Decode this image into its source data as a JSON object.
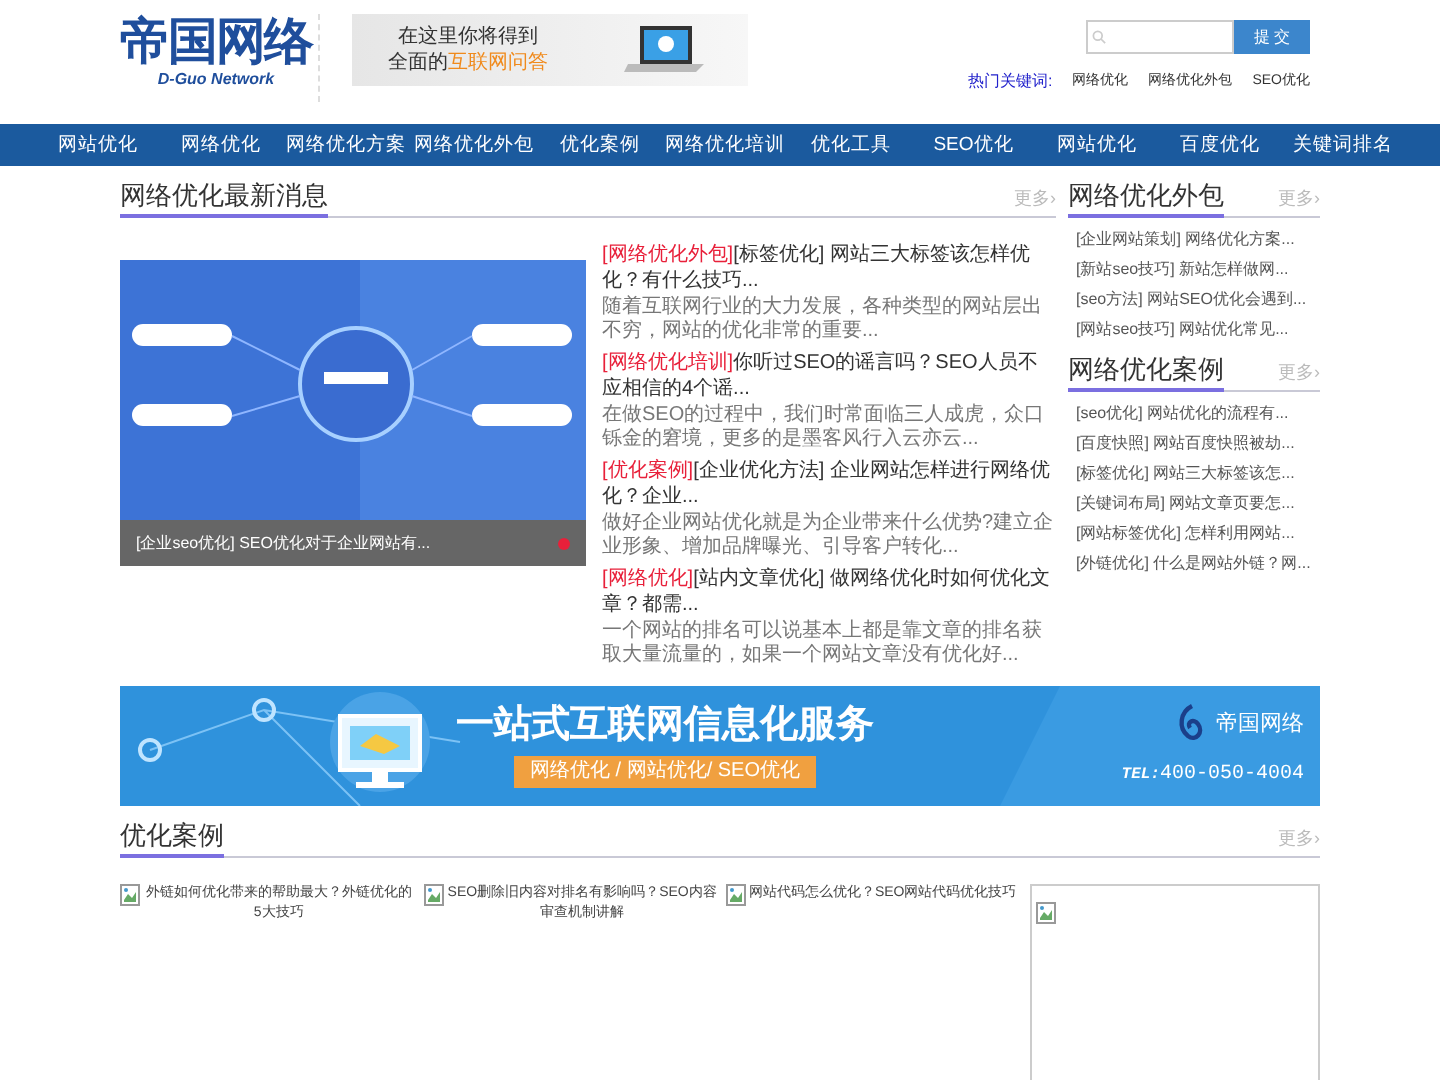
{
  "header": {
    "logo": {
      "name": "帝国网络",
      "subtitle": "D-Guo Network"
    },
    "ad": {
      "line1": "在这里你将得到",
      "line2_prefix": "全面的",
      "line2_highlight": "互联网问答"
    },
    "search": {
      "button": "提 交"
    },
    "hot_keywords": {
      "label": "热门关键词:",
      "items": [
        "网络优化",
        "网络优化外包",
        "SEO优化"
      ]
    }
  },
  "nav": {
    "items": [
      "网站优化",
      "网络优化",
      "网络优化方案",
      "网络优化外包",
      "优化案例",
      "网络优化培训",
      "优化工具",
      "SEO优化",
      "网站优化",
      "百度优化",
      "关键词排名"
    ]
  },
  "news": {
    "title": "网络优化最新消息",
    "more": "更多›",
    "featured": {
      "caption": "[企业seo优化] SEO优化对于企业网站有..."
    },
    "items": [
      {
        "tag": "[网络优化外包]",
        "title": "[标签优化] 网站三大标签该怎样优化？有什么技巧...",
        "summary": "随着互联网行业的大力发展，各种类型的网站层出不穷，网站的优化非常的重要..."
      },
      {
        "tag": "[网络优化培训]",
        "title": "你听过SEO的谣言吗？SEO人员不应相信的4个谣...",
        "summary": "在做SEO的过程中，我们时常面临三人成虎，众口铄金的窘境，更多的是墨客风行入云亦云..."
      },
      {
        "tag": "[优化案例]",
        "title": "[企业优化方法] 企业网站怎样进行网络优化？企业...",
        "summary": "做好企业网站优化就是为企业带来什么优势?建立企业形象、增加品牌曝光、引导客户转化..."
      },
      {
        "tag": "[网络优化]",
        "title": "[站内文章优化] 做网络优化时如何优化文章？都需...",
        "summary": "一个网站的排名可以说基本上都是靠文章的排名获取大量流量的，如果一个网站文章没有优化好..."
      }
    ]
  },
  "sidebar": [
    {
      "title": "网络优化外包",
      "more": "更多›",
      "items": [
        "[企业网站策划] 网络优化方案...",
        "[新站seo技巧] 新站怎样做网...",
        "[seo方法] 网站SEO优化会遇到...",
        "[网站seo技巧] 网站优化常见..."
      ]
    },
    {
      "title": "网络优化案例",
      "more": "更多›",
      "items": [
        "[seo优化] 网站优化的流程有...",
        "[百度快照] 网站百度快照被劫...",
        "[标签优化] 网站三大标签该怎...",
        "[关键词布局] 网站文章页要怎...",
        "[网站标签优化] 怎样利用网站...",
        "[外链优化] 什么是网站外链？网..."
      ]
    }
  ],
  "banner": {
    "headline": "一站式互联网信息化服务",
    "services": "网络优化 / 网站优化/ SEO优化",
    "brand": "帝国网络",
    "tel_label": "TEL:",
    "tel": "400-050-4004"
  },
  "cases": {
    "title": "优化案例",
    "more": "更多›",
    "items": [
      "外链如何优化带来的帮助最大？外链优化的5大技巧",
      "SEO删除旧内容对排名有影响吗？SEO内容审查机制讲解",
      "网站代码怎么优化？SEO网站代码优化技巧"
    ]
  }
}
